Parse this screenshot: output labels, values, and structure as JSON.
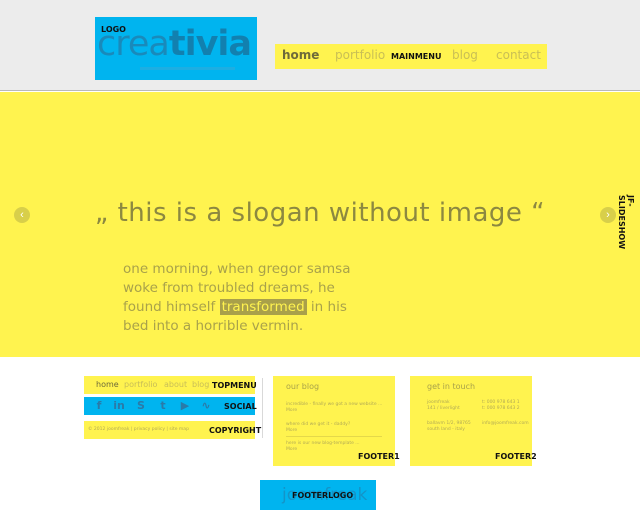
{
  "header": {
    "logo_tag": "LOGO",
    "logo_text_light": "crea",
    "logo_text_bold": "tivia",
    "mainmenu_tag": "MAINMENU",
    "menu": [
      "home",
      "portfolio",
      "blog",
      "contact"
    ]
  },
  "slideshow": {
    "tag": "JF-SLIDESHOW",
    "slogan": "„ this is a slogan without image “",
    "text_before": "one morning, when gregor samsa woke from troubled dreams, he found himself ",
    "text_highlight": "transformed",
    "text_after": " in his bed into a horrible vermin.",
    "prev_icon": "chevron-left-icon",
    "next_icon": "chevron-right-icon"
  },
  "topmenu": {
    "tag": "TOPMENU",
    "items": [
      "home",
      "portfolio",
      "about",
      "blog"
    ]
  },
  "social": {
    "tag": "SOCIAL",
    "icons": [
      "facebook-icon",
      "linkedin-icon",
      "skype-icon",
      "twitter-icon",
      "youtube-icon",
      "rss-icon"
    ],
    "glyphs": [
      "f",
      "in",
      "S",
      "t",
      "▶",
      "∿"
    ]
  },
  "copyright": {
    "tag": "COPYRIGHT",
    "text": "© 2012 joomfreak | privacy policy | site map"
  },
  "footer1": {
    "tag": "FOOTER1",
    "title": "our blog",
    "lines": [
      "incredible - finally we got a new website ...",
      "More",
      "where did we get it - daddy?",
      "More",
      "here is our new blog-template ...",
      "More"
    ]
  },
  "footer2": {
    "tag": "FOOTER2",
    "title": "get in touch",
    "lines": [
      "joomfreak",
      "t: 000 978 643 1",
      "141 / liverlight",
      "t: 000 978 643 2",
      "ballavm 1/2, 98765",
      "info@joomfreak.com",
      "south land - italy"
    ]
  },
  "footerlogo": {
    "tag": "FOOTERLOGO",
    "ghost_text": "joomfreak"
  }
}
